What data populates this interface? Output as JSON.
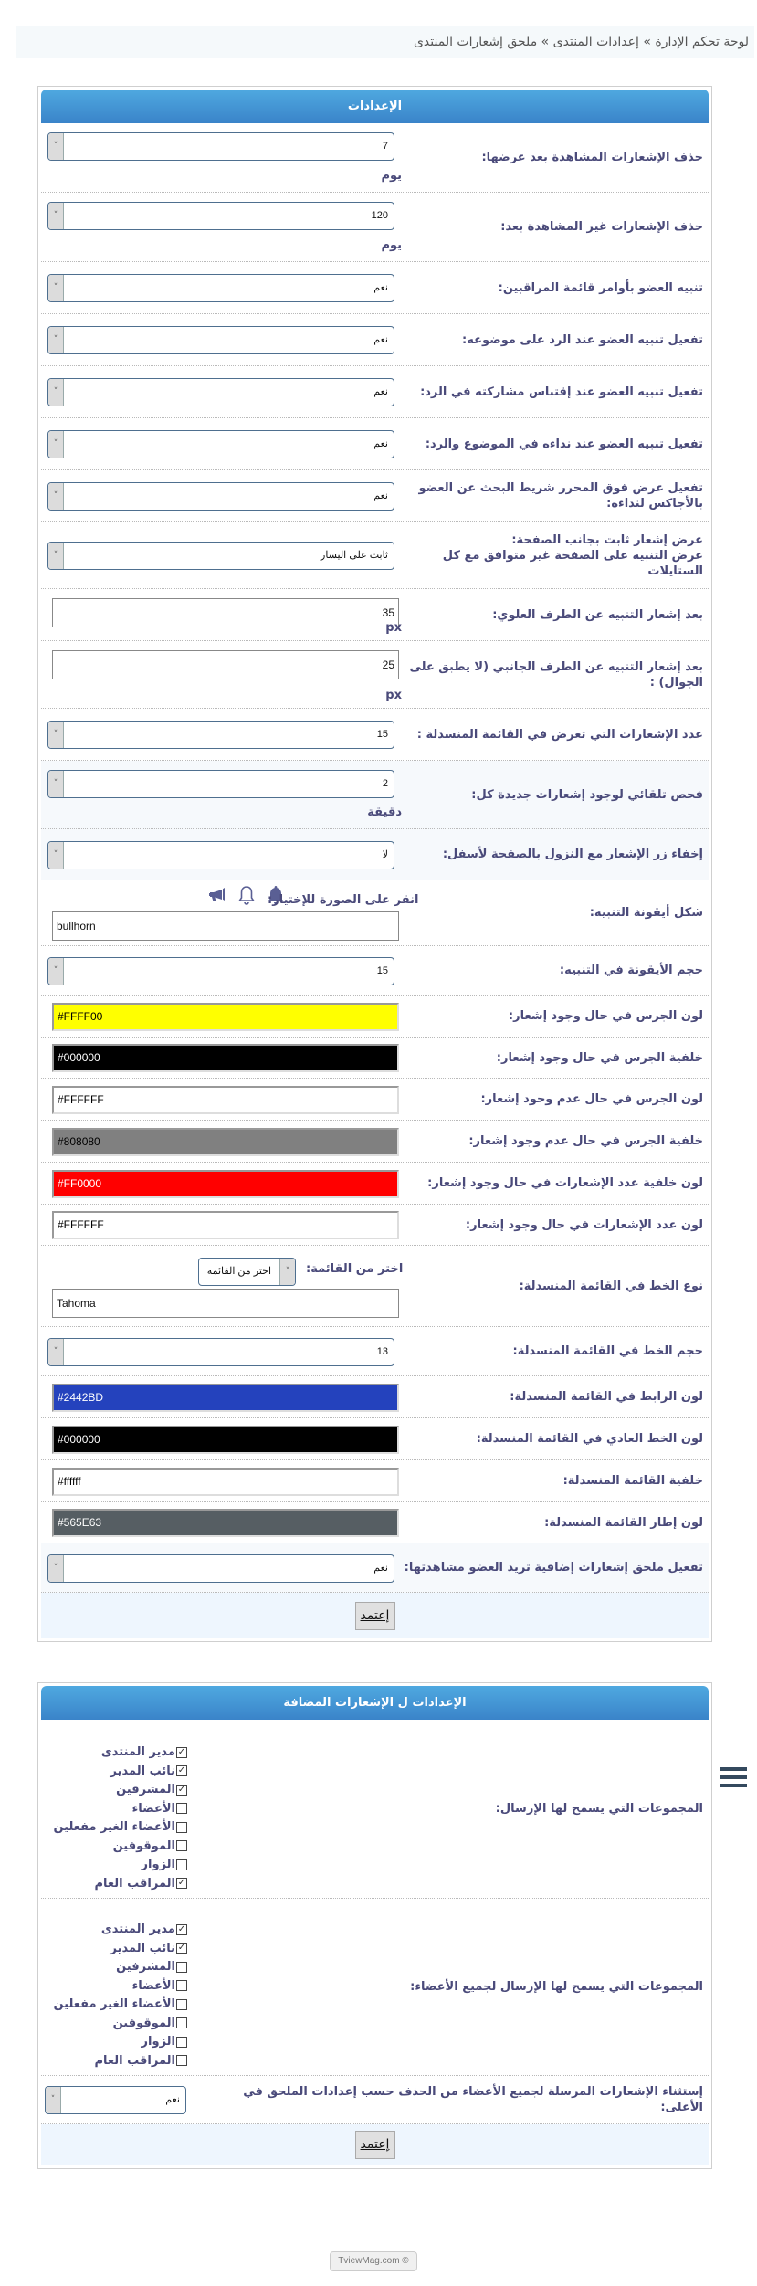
{
  "breadcrumb": "لوحة تحكم الإدارة » إعدادات المنتدى » ملحق إشعارات المنتدى",
  "panel1": {
    "title": "الإعدادات",
    "rows": [
      {
        "label": "حذف الإشعارات المشاهدة بعد عرضها:",
        "type": "select",
        "value": "7",
        "unit": "يوم"
      },
      {
        "label": "حذف الإشعارات غير المشاهدة بعد:",
        "type": "select",
        "value": "120",
        "unit": "يوم"
      },
      {
        "label": "تنبيه العضو بأوامر قائمة المراقبين:",
        "type": "select",
        "value": "نعم"
      },
      {
        "label": "تفعيل تنبيه العضو عند الرد على موضوعه:",
        "type": "select",
        "value": "نعم"
      },
      {
        "label": "تفعيل تنبيه العضو عند إقتباس مشاركته في الرد:",
        "type": "select",
        "value": "نعم"
      },
      {
        "label": "تفعيل تنبيه العضو عند نداءه في الموضوع والرد:",
        "type": "select",
        "value": "نعم"
      },
      {
        "label": "تفعيل عرض فوق المحرر شريط البحث عن العضو بالأجاكس لنداءه:",
        "type": "select",
        "value": "نعم"
      },
      {
        "label": "عرض إشعار ثابت بجانب الصفحة:",
        "label2": "عرض التنبيه على الصفحة غير متوافق مع كل الستايلات",
        "type": "select",
        "value": "ثابت على اليسار"
      },
      {
        "label": "بعد إشعار التنبيه عن الطرف العلوي:",
        "type": "text",
        "value": "35",
        "unit": "px"
      },
      {
        "label": "بعد إشعار التنبيه عن الطرف الجانبي (لا يطبق على الجوال) :",
        "type": "text",
        "value": "25",
        "unit": "px"
      },
      {
        "label": "عدد الإشعارات التي تعرض في القائمة المنسدلة :",
        "type": "select",
        "value": "15"
      },
      {
        "label": "فحص تلقائي لوجود إشعارات جديدة كل:",
        "type": "select",
        "value": "2",
        "unit": "دقيقة"
      },
      {
        "label": "إخفاء زر الإشعار مع النزول بالصفحة لأسفل:",
        "type": "select",
        "value": "لا"
      },
      {
        "label": "شكل أيقونة التنبيه:",
        "type": "icon-picker",
        "hint": "انقر على الصورة للإختيار:",
        "icons": [
          "bell-solid",
          "bell-outline",
          "bullhorn"
        ],
        "value": "bullhorn"
      },
      {
        "label": "حجم الأيقونة في التنبيه:",
        "type": "select",
        "value": "15"
      },
      {
        "label": "لون الجرس في حال وجود إشعار:",
        "type": "color",
        "value": "#FFFF00",
        "bg": "#FFFF00",
        "fg": "#000000"
      },
      {
        "label": "خلفية الجرس في حال وجود إشعار:",
        "type": "color",
        "value": "#000000",
        "bg": "#000000",
        "fg": "#FFFFFF"
      },
      {
        "label": "لون الجرس في حال عدم وجود إشعار:",
        "type": "color",
        "value": "#FFFFFF",
        "bg": "#FFFFFF",
        "fg": "#000000"
      },
      {
        "label": "خلفية الجرس في حال عدم وجود إشعار:",
        "type": "color",
        "value": "#808080",
        "bg": "#808080",
        "fg": "#000000"
      },
      {
        "label": "لون خلفية عدد الإشعارات في حال وجود إشعار:",
        "type": "color",
        "value": "#FF0000",
        "bg": "#FF0000",
        "fg": "#FFFFFF"
      },
      {
        "label": "لون عدد الإشعارات في حال وجود إشعار:",
        "type": "color",
        "value": "#FFFFFF",
        "bg": "#FFFFFF",
        "fg": "#000000"
      },
      {
        "label": "نوع الخط في القائمة المنسدلة:",
        "type": "font-picker",
        "hint": "اختر من القائمة:",
        "select_value": "اختر من القائمة",
        "value": "Tahoma"
      },
      {
        "label": "حجم الخط في القائمة المنسدلة:",
        "type": "select",
        "value": "13"
      },
      {
        "label": "لون الرابط في القائمة المنسدلة:",
        "type": "color",
        "value": "#2442BD",
        "bg": "#2442BD",
        "fg": "#FFFFFF"
      },
      {
        "label": "لون الخط العادي في القائمة المنسدلة:",
        "type": "color",
        "value": "#000000",
        "bg": "#000000",
        "fg": "#FFFFFF"
      },
      {
        "label": "خلفية القائمة المنسدلة:",
        "type": "color",
        "value": "#ffffff",
        "bg": "#FFFFFF",
        "fg": "#000000"
      },
      {
        "label": "لون إطار القائمة المنسدلة:",
        "type": "color",
        "value": "#565E63",
        "bg": "#565E63",
        "fg": "#FFFFFF"
      },
      {
        "label": "تفعيل ملحق إشعارات إضافية تريد العضو مشاهدتها:",
        "type": "select",
        "value": "نعم"
      }
    ],
    "submit_label": "إعتمد"
  },
  "panel2": {
    "title": "الإعدادات ل الإشعارات المضافة",
    "send_groups": {
      "label": "المجموعات التي يسمح لها الإرسال:",
      "items": [
        {
          "label": "مدير المنتدى",
          "checked": true
        },
        {
          "label": "نائب المدير",
          "checked": true
        },
        {
          "label": "المشرفين",
          "checked": true
        },
        {
          "label": "الأعضاء",
          "checked": false
        },
        {
          "label": "الأعضاء الغير مفعلين",
          "checked": false
        },
        {
          "label": "الموقوفين",
          "checked": false
        },
        {
          "label": "الزوار",
          "checked": false
        },
        {
          "label": "المراقب العام",
          "checked": true
        }
      ]
    },
    "send_all_groups": {
      "label": "المجموعات التي يسمح لها الإرسال لجميع الأعضاء:",
      "items": [
        {
          "label": "مدير المنتدى",
          "checked": true
        },
        {
          "label": "نائب المدير",
          "checked": true
        },
        {
          "label": "المشرفين",
          "checked": false
        },
        {
          "label": "الأعضاء",
          "checked": false
        },
        {
          "label": "الأعضاء الغير مفعلين",
          "checked": false
        },
        {
          "label": "الموقوفين",
          "checked": false
        },
        {
          "label": "الزوار",
          "checked": false
        },
        {
          "label": "المراقب العام",
          "checked": false
        }
      ]
    },
    "exclude": {
      "label": "إستثناء الإشعارات المرسلة لجميع الأعضاء من الحذف حسب إعدادات الملحق في الأعلى:",
      "value": "نعم"
    },
    "submit_label": "إعتمد"
  },
  "footer": "TviewMag.com ©",
  "icons": {
    "dropdown_arrow": "˅",
    "check": "✓"
  }
}
